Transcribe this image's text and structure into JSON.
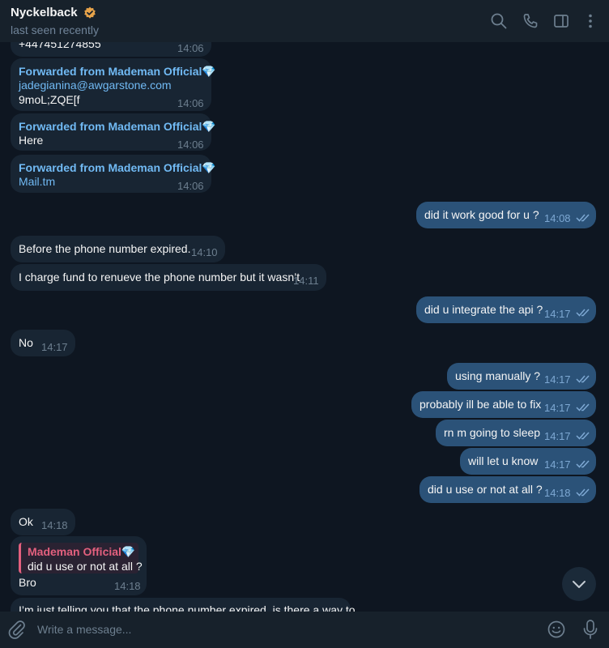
{
  "header": {
    "name": "Nyckelback",
    "status": "last seen recently",
    "verified_color": "#e7a34a"
  },
  "messages": [
    {
      "text": "+447451274855",
      "time": "14:06"
    },
    {
      "forwarded": "Forwarded from Mademan Official💎",
      "link": "jadegianina@awgarstone.com",
      "text": "9moL;ZQE[f",
      "time": "14:06"
    },
    {
      "forwarded": "Forwarded from Mademan Official💎",
      "text": "Here",
      "time": "14:06"
    },
    {
      "forwarded": "Forwarded from Mademan Official💎",
      "link": "Mail.tm",
      "time": "14:06"
    },
    {
      "text": "did it work good for u  ?",
      "time": "14:08"
    },
    {
      "text": "Before the phone number expired.",
      "time": "14:10"
    },
    {
      "text": "I charge fund to renueve the phone number but it wasn’t",
      "time": "14:11"
    },
    {
      "text": "did u integrate the api ?",
      "time": "14:17"
    },
    {
      "text": "No",
      "time": "14:17"
    },
    {
      "text": "using manually ?",
      "time": "14:17"
    },
    {
      "text": "probably ill be able to fix",
      "time": "14:17"
    },
    {
      "text": "rn m going to sleep",
      "time": "14:17"
    },
    {
      "text": "will let u know",
      "time": "14:17"
    },
    {
      "text": "did u use or not at all ?",
      "time": "14:18"
    },
    {
      "text": "Ok",
      "time": "14:18"
    },
    {
      "reply_name": "Mademan Official💎",
      "reply_text": "did u use or not at all ?",
      "text": "Bro",
      "time": "14:18"
    },
    {
      "text": "I’m just telling you that the phone number expired, is there a way to"
    }
  ],
  "composer": {
    "placeholder": "Write a message..."
  },
  "colors": {
    "background": "#0e1621",
    "incoming": "#182533",
    "outgoing": "#2b5278",
    "link": "#71baf4",
    "reply_accent": "#e3607e"
  }
}
